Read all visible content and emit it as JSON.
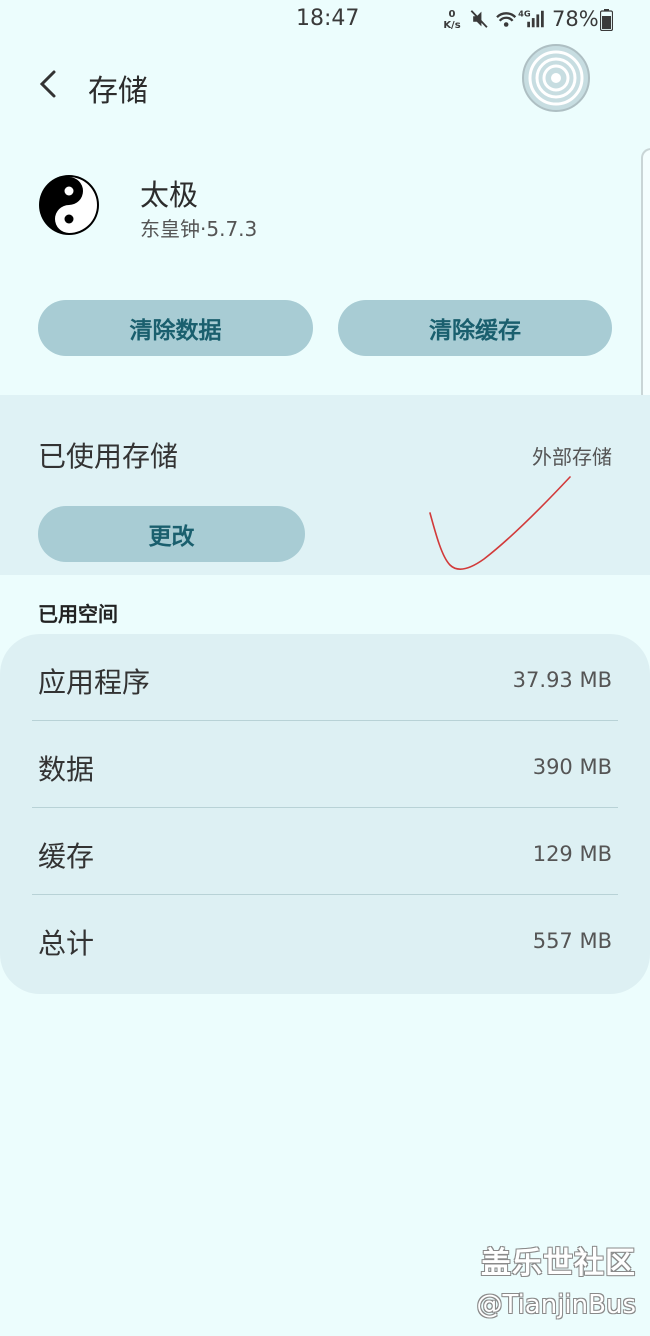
{
  "status_bar": {
    "time": "18:47",
    "net_speed_value": "0",
    "net_speed_unit": "K/s",
    "network_type": "4G",
    "battery_percent": "78%",
    "icons": [
      "mute-icon",
      "wifi-icon",
      "signal-icon",
      "battery-icon"
    ]
  },
  "header": {
    "title": "存储",
    "back_icon": "chevron-left-icon"
  },
  "app": {
    "name": "太极",
    "version": "东皇钟·5.7.3",
    "icon": "yin-yang-icon"
  },
  "actions": {
    "clear_data": "清除数据",
    "clear_cache": "清除缓存"
  },
  "storage_used": {
    "label": "已使用存储",
    "value": "外部存储",
    "change_button": "更改"
  },
  "space_used": {
    "header": "已用空间",
    "rows": [
      {
        "label": "应用程序",
        "value": "37.93 MB"
      },
      {
        "label": "数据",
        "value": "390 MB"
      },
      {
        "label": "缓存",
        "value": "129 MB"
      },
      {
        "label": "总计",
        "value": "557 MB"
      }
    ]
  },
  "watermark": {
    "line1": "盖乐世社区",
    "line2": "@TianjinBus"
  },
  "colors": {
    "background": "#ecfdfd",
    "button_bg": "#a8ccd4",
    "button_text": "#1a5f6e",
    "annotation_stroke": "#d23a3a"
  }
}
